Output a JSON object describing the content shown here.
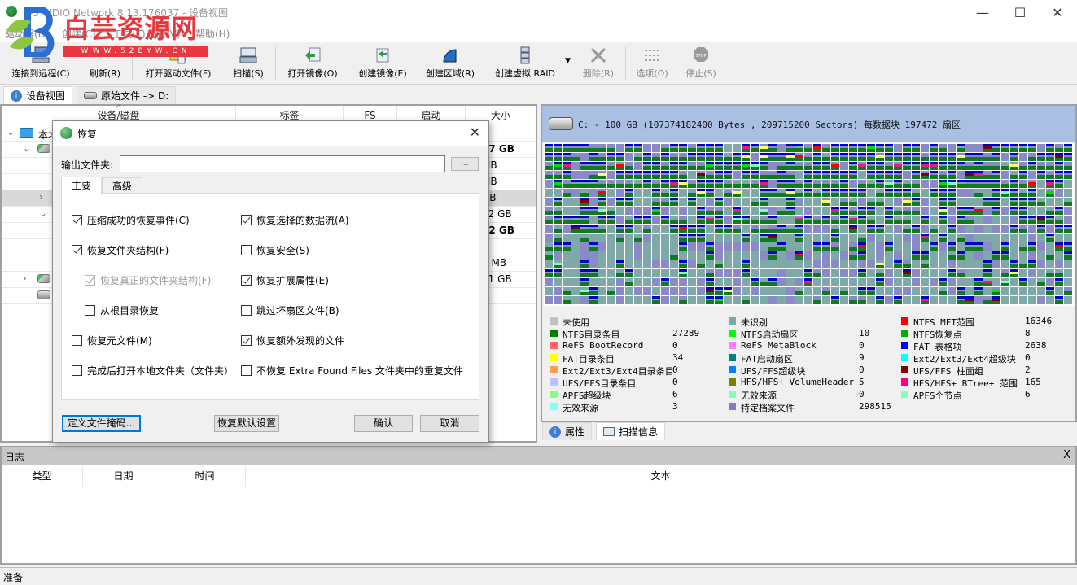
{
  "window": {
    "title": "R-STUDIO Network 8.13.176037 - 设备视图",
    "controls": {
      "minimize": "—",
      "maximize": "☐",
      "close": "✕"
    }
  },
  "watermark": {
    "text": "白芸资源网",
    "url": "WWW.52BYW.CN"
  },
  "menu": [
    "驱动器(D)",
    "创建(C)",
    "工具(T)",
    "查看(V)",
    "帮助(H)"
  ],
  "toolbar": [
    {
      "label": "连接到远程(C)",
      "icon": "network-computer-icon",
      "enabled": true
    },
    {
      "label": "刷新(R)",
      "icon": "refresh-icon",
      "enabled": true
    },
    {
      "label": "打开驱动文件(F)",
      "icon": "open-folder-icon",
      "enabled": true
    },
    {
      "label": "扫描(S)",
      "icon": "scan-icon",
      "enabled": true
    },
    {
      "label": "打开镜像(O)",
      "icon": "open-image-icon",
      "enabled": true
    },
    {
      "label": "创建镜像(E)",
      "icon": "create-image-icon",
      "enabled": true
    },
    {
      "label": "创建区域(R)",
      "icon": "create-region-icon",
      "enabled": true
    },
    {
      "label": "创建虚拟 RAID",
      "icon": "raid-icon",
      "enabled": true
    },
    {
      "label": "删除(R)",
      "icon": "delete-icon",
      "enabled": false
    },
    {
      "label": "选项(O)",
      "icon": "options-icon",
      "enabled": false
    },
    {
      "label": "停止(S)",
      "icon": "stop-icon",
      "enabled": false
    }
  ],
  "left_tabs": [
    {
      "label": "设备视图",
      "active": true
    },
    {
      "label": "原始文件 -> D:",
      "active": false
    }
  ],
  "device_table": {
    "columns": [
      "设备/磁盘",
      "标签",
      "FS",
      "启动",
      "大小"
    ],
    "root_label": "本地",
    "rows": [
      {
        "size": "37 GB",
        "bold": true
      },
      {
        "size": "MB",
        "bold": false
      },
      {
        "size": "MB",
        "bold": false
      },
      {
        "size": "GB",
        "bold": false,
        "selected": true
      },
      {
        "size": "52 GB",
        "bold": false
      },
      {
        "size": "52 GB",
        "bold": true
      },
      {
        "size": "",
        "bold": false
      },
      {
        "size": "0 MB",
        "bold": false
      },
      {
        "size": "51 GB",
        "bold": false
      },
      {
        "size": "",
        "bold": false
      }
    ]
  },
  "disk_info": {
    "header": "C: - 100 GB (107374182400 Bytes , 209715200 Sectors) 每数据块 197472 扇区"
  },
  "legend": [
    [
      {
        "name": "未使用",
        "value": "",
        "color": "#c0c0c0"
      },
      {
        "name": "NTFS目录条目",
        "value": "27289",
        "color": "#008000"
      },
      {
        "name": "ReFS BootRecord",
        "value": "0",
        "color": "#ff6666"
      },
      {
        "name": "FAT目录条目",
        "value": "34",
        "color": "#ffff00"
      },
      {
        "name": "Ext2/Ext3/Ext4目录条目",
        "value": "0",
        "color": "#ffa050"
      },
      {
        "name": "UFS/FFS目录条目",
        "value": "0",
        "color": "#c0c0ff"
      },
      {
        "name": "APFS超级块",
        "value": "6",
        "color": "#80ff80"
      },
      {
        "name": "无效来源",
        "value": "3",
        "color": "#80ffff"
      }
    ],
    [
      {
        "name": "未识别",
        "value": "",
        "color": "#7fa9a9"
      },
      {
        "name": "NTFS启动扇区",
        "value": "10",
        "color": "#00ff00"
      },
      {
        "name": "ReFS MetaBlock",
        "value": "0",
        "color": "#ff80ff"
      },
      {
        "name": "FAT启动扇区",
        "value": "9",
        "color": "#008080"
      },
      {
        "name": "UFS/FFS超级块",
        "value": "0",
        "color": "#0080ff"
      },
      {
        "name": "HFS/HFS+ VolumeHeader",
        "value": "5",
        "color": "#808000"
      },
      {
        "name": "无效来源",
        "value": "0",
        "color": "#80ffc0"
      },
      {
        "name": "特定档案文件",
        "value": "298515",
        "color": "#8080c0"
      }
    ],
    [
      {
        "name": "NTFS MFT范围",
        "value": "16346",
        "color": "#ff0000"
      },
      {
        "name": "NTFS恢复点",
        "value": "8",
        "color": "#00b000"
      },
      {
        "name": "FAT 表格项",
        "value": "2638",
        "color": "#0000ff"
      },
      {
        "name": "Ext2/Ext3/Ext4超级块",
        "value": "0",
        "color": "#00ffff"
      },
      {
        "name": "UFS/FFS 柱面组",
        "value": "2",
        "color": "#800000"
      },
      {
        "name": "HFS/HFS+ BTree+ 范围",
        "value": "165",
        "color": "#ff0080"
      },
      {
        "name": "APFS个节点",
        "value": "6",
        "color": "#80ffc0"
      }
    ]
  ],
  "right_tabs": [
    {
      "label": "属性",
      "active": false
    },
    {
      "label": "扫描信息",
      "active": true
    }
  ],
  "log": {
    "title": "日志",
    "close": "X",
    "columns": [
      "类型",
      "日期",
      "时间",
      "文本"
    ]
  },
  "status": "准备",
  "dialog": {
    "title": "恢复",
    "close": "✕",
    "output_label": "输出文件夹:",
    "output_value": "",
    "browse_label": "...",
    "tabs": [
      {
        "label": "主要",
        "active": true
      },
      {
        "label": "高级",
        "active": false
      }
    ],
    "options_left": [
      {
        "label": "压缩成功的恢复事件(C)",
        "checked": true,
        "enabled": true,
        "indent": false
      },
      {
        "label": "恢复文件夹结构(F)",
        "checked": true,
        "enabled": true,
        "indent": false
      },
      {
        "label": "恢复真正的文件夹结构(F)",
        "checked": true,
        "enabled": false,
        "indent": true
      },
      {
        "label": "从根目录恢复",
        "checked": false,
        "enabled": true,
        "indent": true
      },
      {
        "label": "恢复元文件(M)",
        "checked": false,
        "enabled": true,
        "indent": false
      },
      {
        "label": "完成后打开本地文件夹（文件夹）",
        "checked": false,
        "enabled": true,
        "indent": false
      }
    ],
    "options_right": [
      {
        "label": "恢复选择的数据流(A)",
        "checked": true,
        "enabled": true
      },
      {
        "label": "恢复安全(S)",
        "checked": false,
        "enabled": true
      },
      {
        "label": "恢复扩展属性(E)",
        "checked": true,
        "enabled": true
      },
      {
        "label": "跳过坏扇区文件(B)",
        "checked": false,
        "enabled": true
      },
      {
        "label": "恢复额外发现的文件",
        "checked": true,
        "enabled": true
      },
      {
        "label": "不恢复 Extra Found Files 文件夹中的重复文件",
        "checked": false,
        "enabled": true
      }
    ],
    "buttons": {
      "define_mask": "定义文件掩码...",
      "restore_defaults": "恢复默认设置",
      "ok": "确认",
      "cancel": "取消"
    }
  }
}
